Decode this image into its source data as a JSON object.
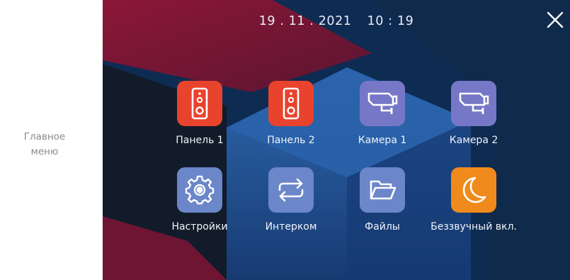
{
  "side_label": [
    "Главное",
    "меню"
  ],
  "header": {
    "date": "19 . 11 . 2021",
    "time": "10 : 19"
  },
  "close": {
    "icon": "close-icon"
  },
  "tiles": [
    {
      "label": "Панель 1",
      "icon": "doorbell-panel-icon",
      "color": "#e8432d"
    },
    {
      "label": "Панель 2",
      "icon": "doorbell-panel-icon",
      "color": "#e8432d"
    },
    {
      "label": "Камера 1",
      "icon": "cctv-camera-icon",
      "color": "#7677c6"
    },
    {
      "label": "Камера 2",
      "icon": "cctv-camera-icon",
      "color": "#7677c6"
    },
    {
      "label": "Настройки",
      "icon": "gear-icon",
      "color": "#6b86c9"
    },
    {
      "label": "Интерком",
      "icon": "intercom-arrows-icon",
      "color": "#6b86c9"
    },
    {
      "label": "Файлы",
      "icon": "folder-icon",
      "color": "#6b86c9"
    },
    {
      "label": "Беззвучный вкл.",
      "icon": "moon-icon",
      "color": "#f08a1c"
    }
  ]
}
